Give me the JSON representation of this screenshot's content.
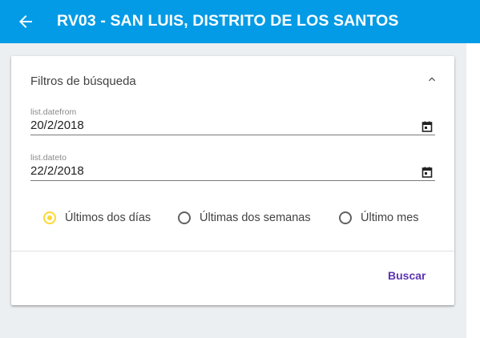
{
  "appbar": {
    "title": "RV03 - SAN LUIS, DISTRITO DE LOS SANTOS",
    "back_icon": "arrow-left-icon",
    "color": "#039be5"
  },
  "filters": {
    "title": "Filtros de búsqueda",
    "collapse_icon": "chevron-up-icon",
    "date_from": {
      "label": "list.datefrom",
      "value": "20/2/2018",
      "icon": "calendar-icon"
    },
    "date_to": {
      "label": "list.dateto",
      "value": "22/2/2018",
      "icon": "calendar-icon"
    },
    "radio_options": [
      {
        "label": "Últimos dos días",
        "selected": true
      },
      {
        "label": "Últimas dos semanas",
        "selected": false
      },
      {
        "label": "Último mes",
        "selected": false
      }
    ],
    "selected_color": "#fdd835",
    "search_button": "Buscar",
    "search_button_color": "#5e35b1"
  }
}
